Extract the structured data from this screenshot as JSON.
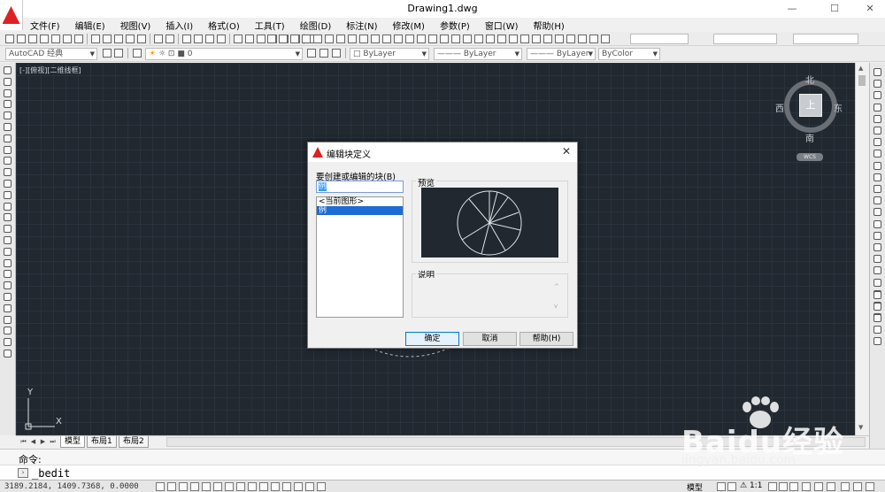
{
  "window": {
    "title": "Drawing1.dwg",
    "minimize": "—",
    "maximize": "☐",
    "close": "✕"
  },
  "menu": {
    "items": [
      "文件(F)",
      "编辑(E)",
      "视图(V)",
      "插入(I)",
      "格式(O)",
      "工具(T)",
      "绘图(D)",
      "标注(N)",
      "修改(M)",
      "参数(P)",
      "窗口(W)",
      "帮助(H)"
    ]
  },
  "toolbar2": {
    "workspace": "AutoCAD 经典",
    "layer": "0",
    "color": "ByLayer",
    "linetype": "ByLayer",
    "lineweight": "ByLayer",
    "plotstyle": "ByColor"
  },
  "drawing": {
    "view_label": "[-][俯视][二维线框]"
  },
  "viewcube": {
    "north": "北",
    "south": "南",
    "east": "东",
    "west": "西",
    "face": "上",
    "wcs": "WCS"
  },
  "ucs": {
    "x": "X",
    "y": "Y"
  },
  "tabs": {
    "items": [
      "模型",
      "布局1",
      "布局2"
    ]
  },
  "command": {
    "history": "命令:",
    "input": "_bedit"
  },
  "status": {
    "coords": "3189.2184, 1409.7368, 0.0000",
    "model": "模型",
    "scale": "1:1"
  },
  "dialog": {
    "title": "编辑块定义",
    "block_label": "要创建或编辑的块(B)",
    "block_name": "例",
    "list_items": [
      "<当前图形>",
      "例"
    ],
    "selected_index": 1,
    "preview_label": "预览",
    "description_label": "说明",
    "ok": "确定",
    "cancel": "取消",
    "help": "帮助(H)"
  },
  "watermark": {
    "brand": "Baidu经验",
    "url": "jingyan.baidu.com"
  },
  "colors": {
    "canvas": "#212830",
    "selection": "#1e6bd6",
    "accent": "#d22222"
  }
}
